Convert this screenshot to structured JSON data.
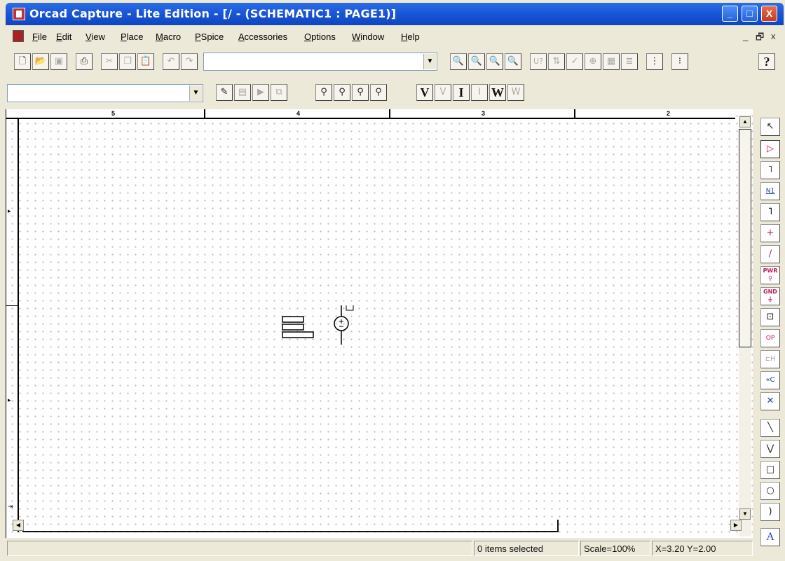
{
  "window": {
    "title": "Orcad Capture - Lite Edition - [/ - (SCHEMATIC1 : PAGE1)]",
    "minimize": "_",
    "restore": "□",
    "close": "X"
  },
  "menubar": {
    "items": [
      "File",
      "Edit",
      "View",
      "Place",
      "Macro",
      "PSpice",
      "Accessories",
      "Options",
      "Window",
      "Help"
    ],
    "mdi_minimize": "_",
    "mdi_restore": "🗗",
    "mdi_close": "x"
  },
  "toolbar1": {
    "part_combo_value": "",
    "buttons": [
      "new-file",
      "open-folder",
      "save",
      "print",
      "cut",
      "copy",
      "paste",
      "undo",
      "redo",
      "zoom-in",
      "zoom-out",
      "zoom-area",
      "zoom-all",
      "annotate",
      "back-annotate",
      "design-rules-check",
      "create-netlist",
      "cross-reference",
      "bill-of-materials",
      "snap-to-grid",
      "project-manager",
      "help"
    ],
    "labels": {
      "annotate": "U?",
      "help": "?"
    }
  },
  "toolbar2": {
    "profile_combo_value": "",
    "marker_labels": {
      "voltage": "V",
      "current": "I",
      "power": "W"
    }
  },
  "canvas": {
    "ruler_labels": [
      "5",
      "4",
      "3",
      "2"
    ]
  },
  "palette": {
    "tools": [
      "select",
      "place-part",
      "place-wire",
      "place-net-alias",
      "place-bus",
      "place-junction",
      "place-bus-entry",
      "place-power",
      "place-ground",
      "place-hierarchical-block",
      "place-hierarchical-port",
      "place-hierarchical-pin",
      "place-off-page-connector",
      "place-no-connect",
      "place-line",
      "place-polyline",
      "place-rectangle",
      "place-ellipse",
      "place-arc",
      "place-text"
    ],
    "labels": {
      "net_alias": "N1",
      "power": "PWR",
      "ground": "GND",
      "offpage": "«C",
      "text": "A",
      "hierport": "OP"
    }
  },
  "statusbar": {
    "selection": "0 items selected",
    "scale": "Scale=100%",
    "coords": "X=3.20  Y=2.00"
  }
}
